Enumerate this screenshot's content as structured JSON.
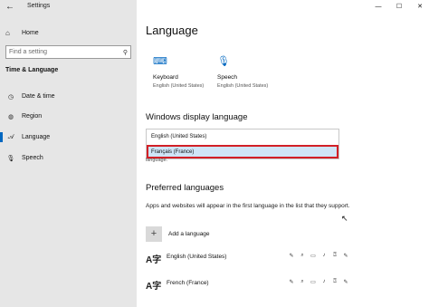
{
  "titlebar": {
    "back_glyph": "←",
    "title": "Settings",
    "minimize_glyph": "—",
    "maximize_glyph": "☐",
    "close_glyph": "✕"
  },
  "sidebar": {
    "home": {
      "icon": "home-icon",
      "glyph": "⌂",
      "label": "Home"
    },
    "search": {
      "placeholder": "Find a setting",
      "icon": "search-icon",
      "glyph": "⚲"
    },
    "section_title": "Time & Language",
    "items": [
      {
        "label": "Date & time",
        "icon": "calendar-clock-icon",
        "glyph": "◷",
        "active": false
      },
      {
        "label": "Region",
        "icon": "globe-icon",
        "glyph": "◍",
        "active": false
      },
      {
        "label": "Language",
        "icon": "language-icon",
        "glyph": "𝒜",
        "active": true
      },
      {
        "label": "Speech",
        "icon": "microphone-icon",
        "glyph": "🎙",
        "active": false
      }
    ]
  },
  "main": {
    "title": "Language",
    "quick_links": [
      {
        "icon": "keyboard-icon",
        "glyph": "⌨",
        "label": "Keyboard",
        "sub": "English (United States)"
      },
      {
        "icon": "microphone-icon",
        "glyph": "🎙",
        "label": "Speech",
        "sub": "English (United States)"
      }
    ],
    "display_language": {
      "heading": "Windows display language",
      "options": [
        {
          "label": "English (United States)",
          "selected": false
        },
        {
          "label": "Français (France)",
          "selected": true
        }
      ],
      "sub": "language."
    },
    "preferred": {
      "heading": "Preferred languages",
      "description": "Apps and websites will appear in the first language in the list that they support.",
      "add_label": "Add a language",
      "add_glyph": "+",
      "languages": [
        {
          "label": "English (United States)",
          "glyph": "A字",
          "features": [
            "✎",
            "⌕",
            "▭",
            "♪",
            "⍰",
            "✎"
          ]
        },
        {
          "label": "French (France)",
          "glyph": "A字",
          "features": [
            "✎",
            "⌕",
            "▭",
            "♪",
            "⍰",
            "✎"
          ]
        }
      ]
    }
  },
  "cursor_glyph": "↖"
}
